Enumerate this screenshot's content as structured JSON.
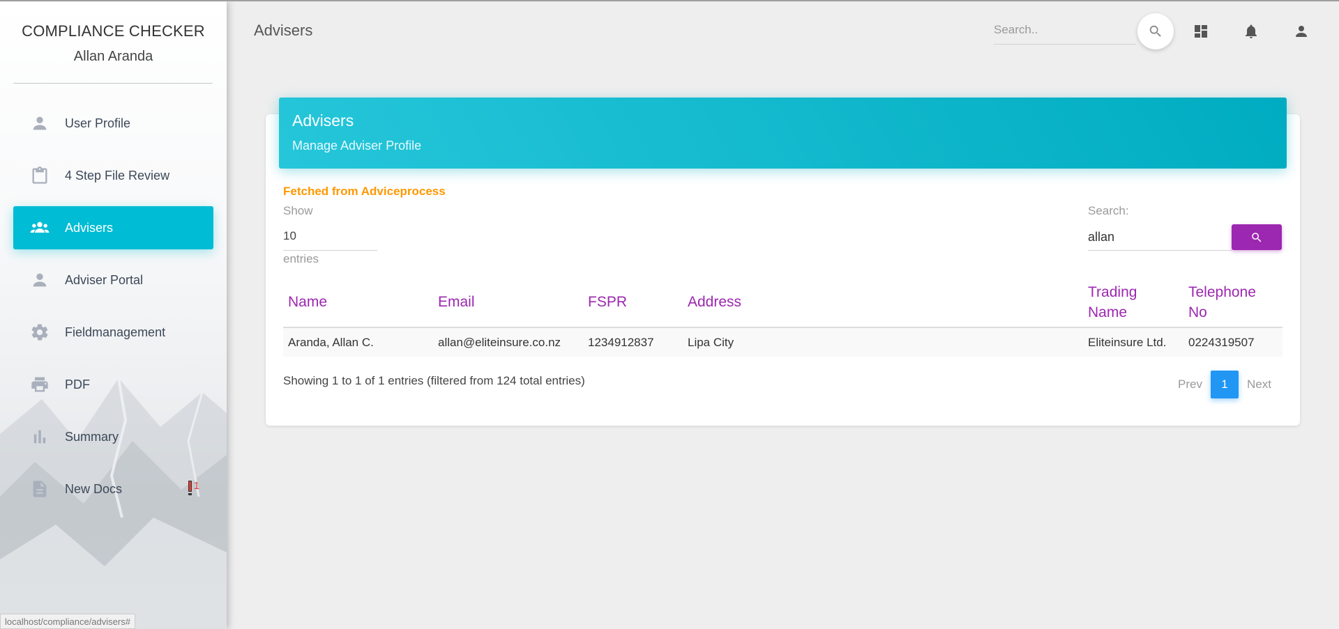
{
  "sidebar": {
    "app_name": "COMPLIANCE CHECKER",
    "user_name": "Allan Aranda",
    "items": [
      {
        "label": "User Profile",
        "icon": "person-icon"
      },
      {
        "label": "4 Step File Review",
        "icon": "clipboard-icon"
      },
      {
        "label": "Advisers",
        "icon": "group-icon",
        "active": true
      },
      {
        "label": "Adviser Portal",
        "icon": "person-icon"
      },
      {
        "label": "Fieldmanagement",
        "icon": "gear-icon"
      },
      {
        "label": "PDF",
        "icon": "printer-icon"
      },
      {
        "label": "Summary",
        "icon": "bar-chart-icon"
      },
      {
        "label": "New Docs",
        "icon": "document-icon",
        "badge": "1"
      }
    ]
  },
  "header": {
    "title": "Advisers",
    "search_placeholder": "Search..",
    "icons": [
      "search-icon",
      "dashboard-icon",
      "bell-icon",
      "person-icon"
    ]
  },
  "card": {
    "title": "Advisers",
    "subtitle": "Manage Adviser Profile",
    "fetched_note": "Fetched from Adviceprocess",
    "show_label": "Show",
    "page_size": "10",
    "entries_label": "entries",
    "search_label": "Search:",
    "search_value": "allan",
    "columns": [
      "Name",
      "Email",
      "FSPR",
      "Address",
      "Trading Name",
      "Telephone No"
    ],
    "rows": [
      [
        "Aranda, Allan C.",
        "allan@eliteinsure.co.nz",
        "1234912837",
        "Lipa City",
        "Eliteinsure Ltd.",
        "0224319507"
      ]
    ],
    "info": "Showing 1 to 1 of 1 entries (filtered from 124 total entries)",
    "pager": {
      "prev": "Prev",
      "current": "1",
      "next": "Next"
    }
  },
  "status_url": "localhost/compliance/advisers#",
  "colors": {
    "accent": "#00bcd4",
    "header_gradient": [
      "#26c6da",
      "#00acc1"
    ],
    "purple": "#9c27b0",
    "orange": "#ff9800",
    "pager_blue": "#2196f3"
  }
}
